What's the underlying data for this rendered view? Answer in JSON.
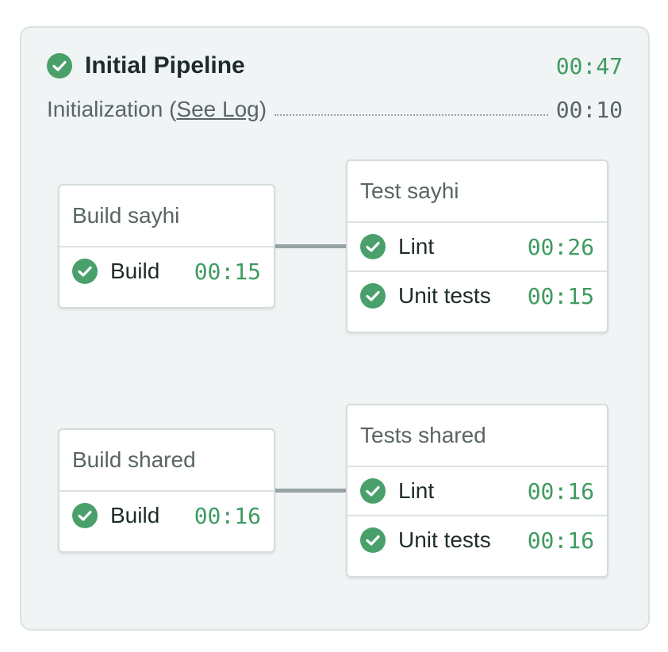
{
  "pipeline": {
    "title": "Initial Pipeline",
    "total_time": "00:47",
    "init_label": "Initialization (",
    "init_link": "See Log",
    "init_close": ")",
    "init_time": "00:10"
  },
  "blocks": [
    {
      "title": "Build sayhi",
      "jobs": [
        {
          "name": "Build",
          "time": "00:15"
        }
      ]
    },
    {
      "title": "Test sayhi",
      "jobs": [
        {
          "name": "Lint",
          "time": "00:26"
        },
        {
          "name": "Unit tests",
          "time": "00:15"
        }
      ]
    },
    {
      "title": "Build shared",
      "jobs": [
        {
          "name": "Build",
          "time": "00:16"
        }
      ]
    },
    {
      "title": "Tests shared",
      "jobs": [
        {
          "name": "Lint",
          "time": "00:16"
        },
        {
          "name": "Unit tests",
          "time": "00:16"
        }
      ]
    }
  ],
  "colors": {
    "success": "#49a06b",
    "panel_bg": "#f0f4f4",
    "connector": "#98a3a3"
  },
  "icons": {
    "status": "check-circle-icon"
  }
}
